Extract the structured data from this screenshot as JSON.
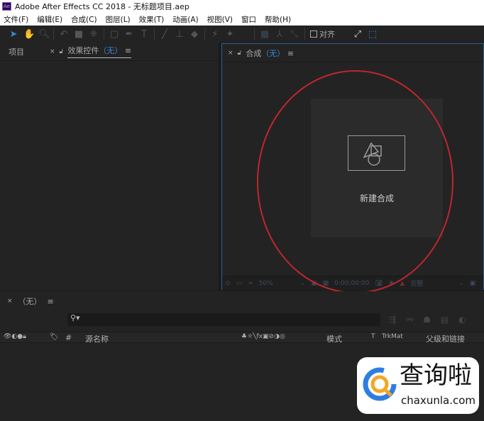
{
  "window": {
    "title": "Adobe After Effects CC 2018 - 无标题项目.aep",
    "logo": "Ae"
  },
  "menu": [
    "文件(F)",
    "编辑(E)",
    "合成(C)",
    "图层(L)",
    "效果(T)",
    "动画(A)",
    "视图(V)",
    "窗口",
    "帮助(H)"
  ],
  "toolbar": {
    "snap_label": "对齐",
    "snap_checked": false
  },
  "left_panel": {
    "tabs": [
      {
        "label": "项目"
      },
      {
        "label": "效果控件",
        "suffix": "（无）"
      }
    ]
  },
  "comp_panel": {
    "tab": "合成",
    "suffix": "（无）",
    "new_comp_label": "新建合成",
    "zoom": "50%",
    "timecode": "0:00:00:00",
    "resolution": "完整"
  },
  "timeline": {
    "tab": "（无）",
    "search_placeholder": "",
    "columns": {
      "hash": "#",
      "source": "源名称",
      "mode": "模式",
      "t": "T",
      "trkmat": "TrkMat",
      "parent": "父级和链接"
    }
  },
  "watermark": {
    "text": "查询啦",
    "url": "chaxunla.com"
  },
  "colors": {
    "accent": "#3d86d6",
    "annotation": "#c0262d",
    "panel": "#232323"
  }
}
